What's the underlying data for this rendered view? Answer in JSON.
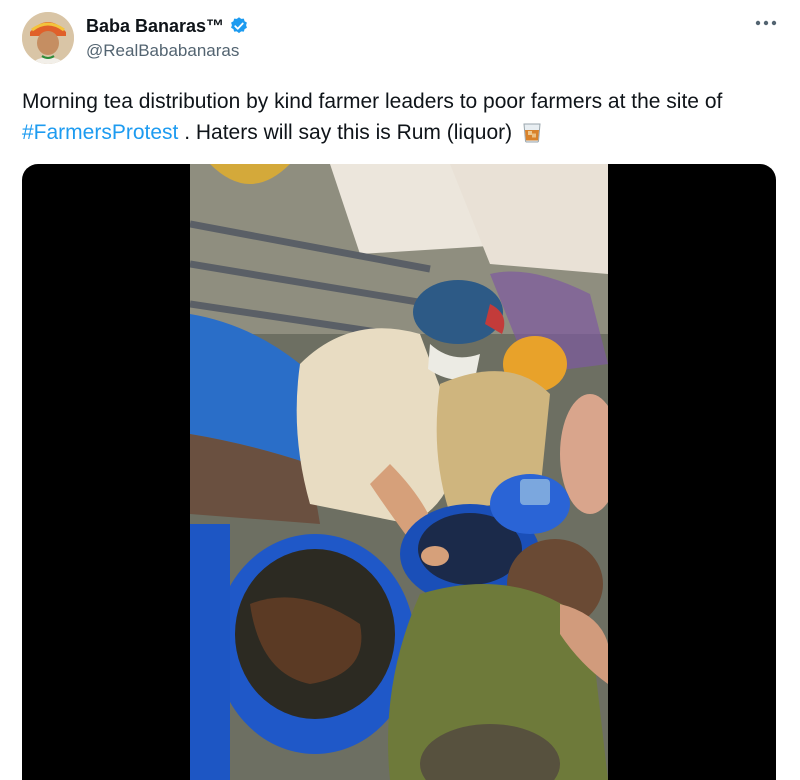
{
  "tweet": {
    "author": {
      "display_name": "Baba Banaras™",
      "handle": "@RealBababanaras",
      "verified_icon": "verified-badge-icon",
      "verified_color": "#1d9bf0"
    },
    "more_icon": "more-horizontal-icon",
    "text": {
      "part1": "Morning tea distribution by kind farmer leaders to poor farmers at the site of ",
      "hashtag": "#FarmersProtest",
      "part2": " . Haters will say this is Rum (liquor)",
      "emoji_icon": "tumbler-glass-icon"
    },
    "media": {
      "type": "video",
      "frame_icon": "video-frame"
    }
  },
  "colors": {
    "text": "#0f1419",
    "secondary": "#536471",
    "link": "#1d9bf0",
    "media_bg": "#000000"
  }
}
